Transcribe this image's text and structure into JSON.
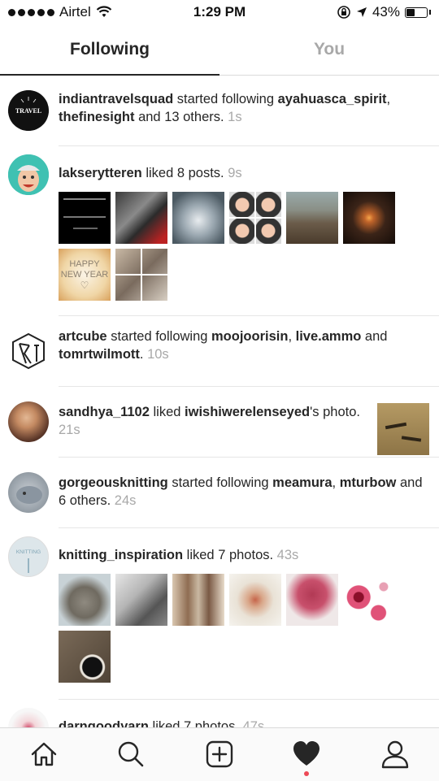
{
  "status_bar": {
    "carrier": "Airtel",
    "time": "1:29 PM",
    "battery": "43%",
    "battery_level": 0.43
  },
  "tabs": {
    "following": "Following",
    "you": "You"
  },
  "feed": [
    {
      "user": "indiantravelsquad",
      "action": " started following ",
      "targets": [
        "ayahuasca_spirit",
        "thefinesight"
      ],
      "sep1": ",",
      "tail": " and 13 others. ",
      "time": "1s",
      "avatar_text": "TRAVEL"
    },
    {
      "user": "lakserytteren",
      "action": " liked 8 posts. ",
      "time": "9s",
      "thumb_text": {
        "happy": "HAPPY",
        "new_year": "NEW YEAR"
      }
    },
    {
      "user": "artcube",
      "action": " started following ",
      "targets": [
        "moojoorisin",
        "live.ammo",
        "tomrtwilmott"
      ],
      "sep1": ",",
      "sep2": " and",
      "tail": ". ",
      "time": "10s"
    },
    {
      "user": "sandhya_1102",
      "action": " liked ",
      "target": "iwishiwerelenseyed",
      "tail": "'s photo. ",
      "time": "21s"
    },
    {
      "user": "gorgeousknitting",
      "action": " started following ",
      "targets": [
        "meamura",
        "mturbow"
      ],
      "sep1": ",",
      "tail": " and 6 others. ",
      "time": "24s"
    },
    {
      "user": "knitting_inspiration",
      "action": " liked 7 photos. ",
      "time": "43s",
      "avatar_text": "KNITTING"
    },
    {
      "user": "darngoodyarn",
      "action": " liked 7 photos. ",
      "time": "47s"
    }
  ],
  "colors": {
    "text": "#262626",
    "muted": "#a8a8a8",
    "accent": "#ed4956",
    "divider": "#e6e6e6"
  },
  "tabbar": {
    "icons": [
      "home-icon",
      "search-icon",
      "add-post-icon",
      "heart-icon",
      "profile-icon"
    ],
    "active": "heart-icon"
  }
}
